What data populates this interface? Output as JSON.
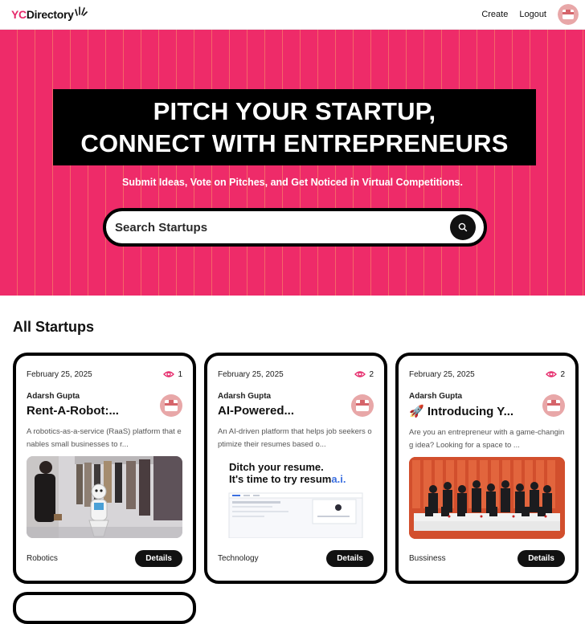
{
  "nav": {
    "logo_yc": "YC",
    "logo_rest": "Directory",
    "create": "Create",
    "logout": "Logout"
  },
  "hero": {
    "title_line1": "PITCH YOUR STARTUP,",
    "title_line2": "CONNECT WITH ENTREPRENEURS",
    "subtitle": "Submit Ideas, Vote on Pitches, and Get Noticed in Virtual Competitions.",
    "search_placeholder": "Search Startups"
  },
  "section": {
    "title": "All Startups"
  },
  "cards": [
    {
      "date": "February 25, 2025",
      "views": "1",
      "author": "Adarsh Gupta",
      "title": "Rent-A-Robot:...",
      "description": "A robotics-as-a-service (RaaS) platform that enables small businesses to r...",
      "category": "Robotics",
      "details": "Details"
    },
    {
      "date": "February 25, 2025",
      "views": "2",
      "author": "Adarsh Gupta",
      "title": "AI-Powered...",
      "description": "An AI-driven platform that helps job seekers optimize their resumes based o...",
      "category": "Technology",
      "details": "Details",
      "image_text_line1": "Ditch your resume.",
      "image_text_line2": "It's time to try resum",
      "image_text_accent": "a.i."
    },
    {
      "date": "February 25, 2025",
      "views": "2",
      "author": "Adarsh Gupta",
      "title_emoji": "🚀",
      "title": "Introducing Y...",
      "description": "Are you an entrepreneur with a game-changing idea? Looking for a space to ...",
      "category": "Bussiness",
      "details": "Details"
    }
  ],
  "colors": {
    "brand_pink": "#ee2b69",
    "stripe": "#ffd666",
    "black": "#000000"
  }
}
